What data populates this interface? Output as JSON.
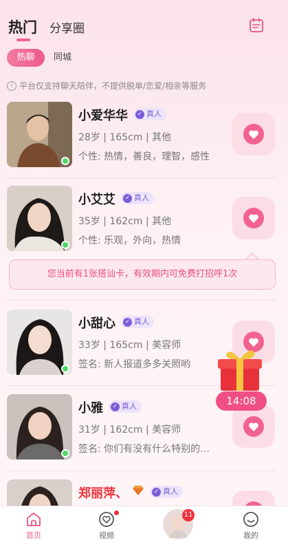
{
  "header": {
    "tab_hot": "热门",
    "tab_share": "分享圈",
    "calendar_icon": "calendar-icon"
  },
  "filters": {
    "active": "热聊",
    "other": "同城"
  },
  "notice": {
    "icon": "info-icon",
    "text": "平台仅支持聊天陪伴，不提供脱单/恋爱/相亲等服务"
  },
  "tip": {
    "text": "您当前有1张搭讪卡，有效期内可免费打招呼1次"
  },
  "profiles": [
    {
      "name": "小爱华华",
      "badge": "真人",
      "info": "28岁 | 165cm | 其他",
      "bio": "个性: 热情，善良，理智，感性"
    },
    {
      "name": "小艾艾",
      "badge": "真人",
      "info": "35岁 | 162cm | 其他",
      "bio": "个性: 乐观，外向，热情"
    },
    {
      "name": "小甜心",
      "badge": "真人",
      "info": "33岁 | 165cm | 美容师",
      "bio": "签名: 新人报道多多关照哟"
    },
    {
      "name": "小雅",
      "badge": "真人",
      "info": "31岁 | 162cm | 美容师",
      "bio": "签名: 你们有没有什么特别的…"
    },
    {
      "name": "郑丽萍、",
      "badge": "真人",
      "info": "",
      "bio": ""
    }
  ],
  "gift": {
    "timer": "14:08"
  },
  "tabbar": {
    "home": "首页",
    "video": "视频",
    "center_badge": "11",
    "mine": "我的"
  },
  "colors": {
    "accent": "#f0628e",
    "name_red": "#f0323c",
    "verified": "#7b5cd6",
    "online": "#4cd964"
  }
}
